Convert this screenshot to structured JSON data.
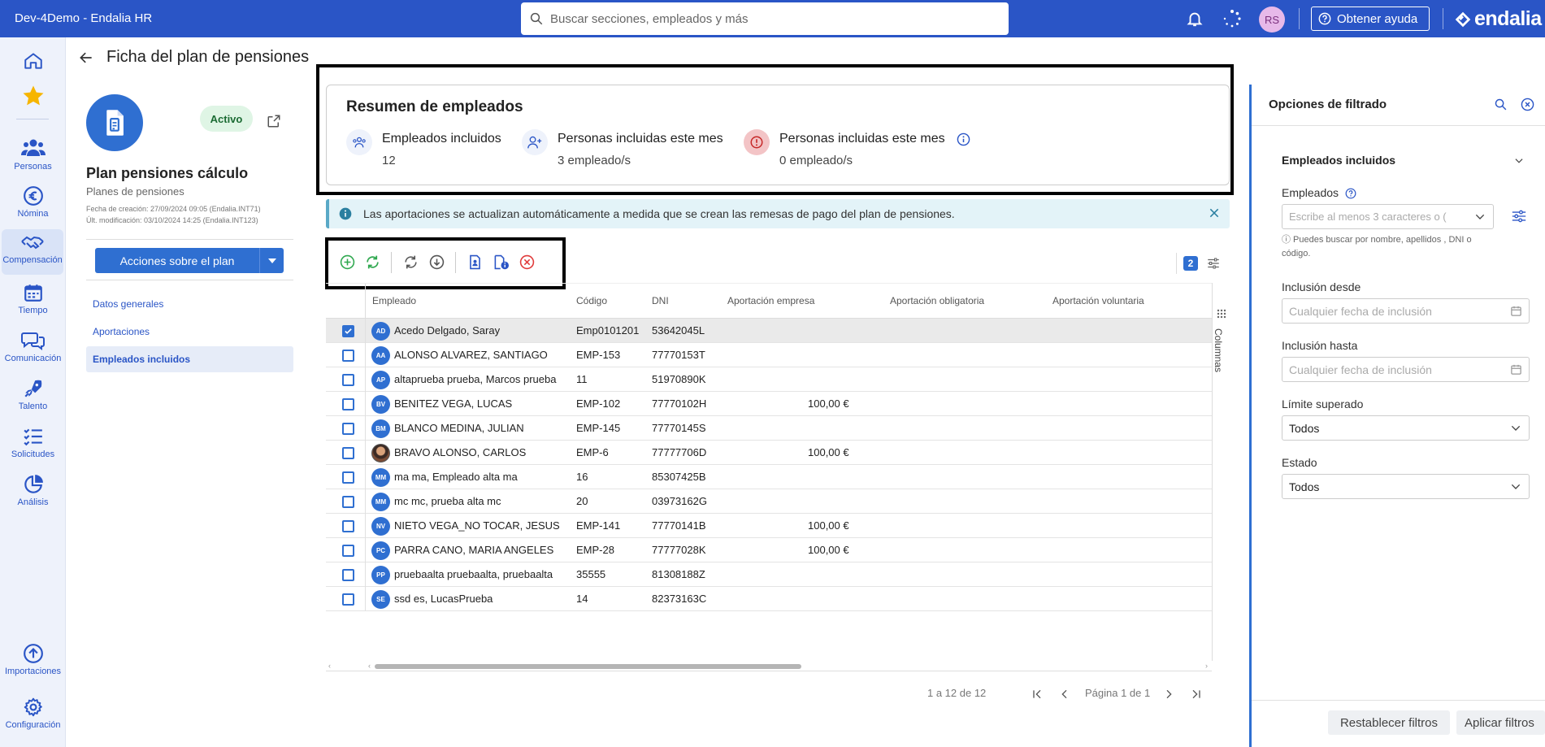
{
  "app": {
    "title": "Dev-4Demo - Endalia HR",
    "brand": "endalia"
  },
  "search": {
    "placeholder": "Buscar secciones, empleados y más"
  },
  "header": {
    "user_initials": "RS",
    "help_label": "Obtener ayuda"
  },
  "nav": {
    "items": [
      {
        "label": "Personas"
      },
      {
        "label": "Nómina"
      },
      {
        "label": "Compensación"
      },
      {
        "label": "Tiempo"
      },
      {
        "label": "Comunicación"
      },
      {
        "label": "Talento"
      },
      {
        "label": "Solicitudes"
      },
      {
        "label": "Análisis"
      },
      {
        "label": "Importaciones"
      },
      {
        "label": "Configuración"
      }
    ]
  },
  "page": {
    "title": "Ficha del plan de pensiones"
  },
  "plan": {
    "status": "Activo",
    "name": "Plan pensiones cálculo",
    "type": "Planes de pensiones",
    "created": "Fecha de creación: 27/09/2024 09:05 (Endalia.INT71)",
    "modified": "Últ. modificación: 03/10/2024 14:25 (Endalia.INT123)",
    "actions_label": "Acciones sobre el plan",
    "nav": [
      "Datos generales",
      "Aportaciones",
      "Empleados incluidos"
    ]
  },
  "summary": {
    "title": "Resumen de empleados",
    "stats": [
      {
        "label": "Empleados incluidos",
        "value": "12"
      },
      {
        "label": "Personas incluidas este mes",
        "value": "3 empleado/s"
      },
      {
        "label": "Personas incluidas este mes",
        "value": "0 empleado/s"
      }
    ]
  },
  "banner": {
    "text": "Las aportaciones se actualizan automáticamente a medida que se crean las remesas de pago del plan de pensiones."
  },
  "grid": {
    "selected_count": "2",
    "columns_label": "Columnas",
    "headers": [
      "Empleado",
      "Código",
      "DNI",
      "Aportación empresa",
      "Aportación obligatoria",
      "Aportación voluntaria"
    ],
    "rows": [
      {
        "initials": "AD",
        "name": "Acedo Delgado, Saray",
        "code": "Emp0101201",
        "dni": "53642045L",
        "company": "",
        "checked": true
      },
      {
        "initials": "AA",
        "name": "ALONSO ALVAREZ, SANTIAGO",
        "code": "EMP-153",
        "dni": "77770153T",
        "company": ""
      },
      {
        "initials": "AP",
        "name": "altaprueba prueba, Marcos prueba",
        "code": "11",
        "dni": "51970890K",
        "company": ""
      },
      {
        "initials": "BV",
        "name": "BENITEZ VEGA, LUCAS",
        "code": "EMP-102",
        "dni": "77770102H",
        "company": "100,00 €"
      },
      {
        "initials": "BM",
        "name": "BLANCO MEDINA, JULIAN",
        "code": "EMP-145",
        "dni": "77770145S",
        "company": ""
      },
      {
        "initials": "",
        "name": "BRAVO ALONSO, CARLOS",
        "code": "EMP-6",
        "dni": "77777706D",
        "company": "100,00 €",
        "photo": true
      },
      {
        "initials": "MM",
        "name": "ma ma, Empleado alta ma",
        "code": "16",
        "dni": "85307425B",
        "company": ""
      },
      {
        "initials": "MM",
        "name": "mc mc, prueba alta mc",
        "code": "20",
        "dni": "03973162G",
        "company": ""
      },
      {
        "initials": "NV",
        "name": "NIETO VEGA_NO TOCAR, JESUS",
        "code": "EMP-141",
        "dni": "77770141B",
        "company": "100,00 €"
      },
      {
        "initials": "PC",
        "name": "PARRA CANO, MARIA ANGELES",
        "code": "EMP-28",
        "dni": "77777028K",
        "company": "100,00 €"
      },
      {
        "initials": "PP",
        "name": "pruebaalta pruebaalta, pruebaalta",
        "code": "35555",
        "dni": "81308188Z",
        "company": ""
      },
      {
        "initials": "SE",
        "name": "ssd es, LucasPrueba",
        "code": "14",
        "dni": "82373163C",
        "company": ""
      }
    ]
  },
  "pagination": {
    "range": "1 a 12 de 12",
    "page": "Página 1 de 1"
  },
  "filters": {
    "title": "Opciones de filtrado",
    "section": "Empleados incluidos",
    "employees_label": "Empleados",
    "employees_placeholder": "Escribe al menos 3 caracteres o (",
    "employees_hint": "ⓘ Puedes buscar por nombre, apellidos , DNI o código.",
    "from_label": "Inclusión desde",
    "from_placeholder": "Cualquier fecha de inclusión",
    "to_label": "Inclusión hasta",
    "to_placeholder": "Cualquier fecha de inclusión",
    "limit_label": "Límite superado",
    "limit_value": "Todos",
    "state_label": "Estado",
    "state_value": "Todos",
    "reset_label": "Restablecer filtros",
    "apply_label": "Aplicar filtros"
  },
  "colors": {
    "primary": "#2a55c6",
    "accent": "#2f6fd1",
    "success": "#2fa84f",
    "danger": "#e03b3b"
  }
}
